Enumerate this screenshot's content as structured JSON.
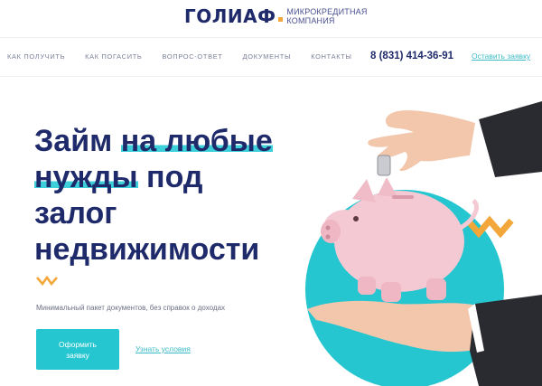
{
  "header": {
    "logo_text": "ГОЛИАФ",
    "logo_sub_line1": "МИКРОКРЕДИТНАЯ",
    "logo_sub_line2": "КОМПАНИЯ"
  },
  "nav": {
    "items": [
      {
        "label": "КАК ПОЛУЧИТЬ"
      },
      {
        "label": "КАК ПОГАСИТЬ"
      },
      {
        "label": "ВОПРОС-ОТВЕТ"
      },
      {
        "label": "ДОКУМЕНТЫ"
      },
      {
        "label": "КОНТАКТЫ"
      }
    ],
    "phone": "8 (831) 414-36-91",
    "apply_link": "Оставить заявку"
  },
  "hero": {
    "line1_plain": "Займ ",
    "line1_highlight": "на любые",
    "line2_highlight": "нужды",
    "line2_plain": " под",
    "line3": "залог",
    "line4": "недвижимости",
    "tagline": "Минимальный пакет документов, без справок о доходах",
    "cta_line1": "Оформить",
    "cta_line2": "заявку",
    "terms_link": "Узнать условия"
  },
  "colors": {
    "brand_navy": "#1f2a6b",
    "accent_teal": "#25c6d0",
    "accent_orange": "#f3a73a",
    "piggy_pink": "#f5c9d3"
  },
  "icons": {
    "zigzag_small": "zigzag-icon",
    "zigzag_large": "zigzag-icon"
  }
}
